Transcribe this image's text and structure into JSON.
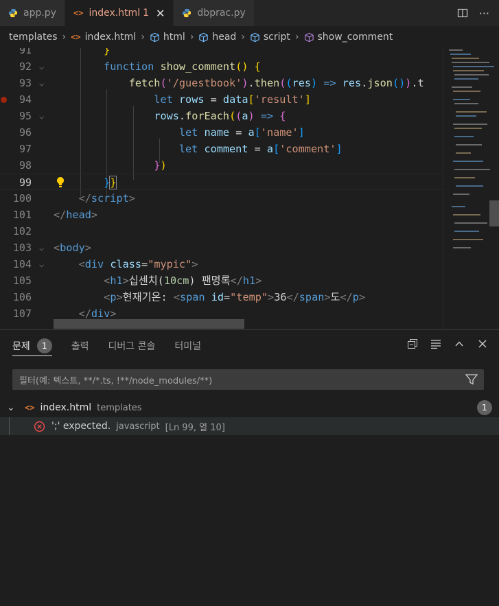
{
  "tabs": [
    {
      "label": "app.py",
      "type": "python",
      "active": false
    },
    {
      "label": "index.html",
      "type": "html",
      "active": true,
      "problems": "1"
    },
    {
      "label": "dbprac.py",
      "type": "python",
      "active": false
    }
  ],
  "breadcrumbs": [
    "templates",
    "index.html",
    "html",
    "head",
    "script",
    "show_comment"
  ],
  "editor": {
    "line_numbers": [
      "91",
      "92",
      "93",
      "94",
      "95",
      "96",
      "97",
      "98",
      "99",
      "100",
      "101",
      "102",
      "103",
      "104",
      "105",
      "106",
      "107"
    ],
    "current_line": "99"
  },
  "panel": {
    "tabs": [
      {
        "label": "문제",
        "count": "1"
      },
      {
        "label": "출력"
      },
      {
        "label": "디버그 콘솔"
      },
      {
        "label": "터미널"
      }
    ],
    "filter_placeholder": "필터(예: 텍스트, **/*.ts, !**/node_modules/**)",
    "file": {
      "name": "index.html",
      "folder": "templates",
      "count": "1"
    },
    "problem": {
      "message": "';' expected.",
      "source": "javascript",
      "location": "[Ln 99, 열 10]"
    }
  },
  "colors": {
    "accent_error": "#f14c4c",
    "html_icon": "#e37933",
    "active_tab_text": "#e8a28a"
  }
}
